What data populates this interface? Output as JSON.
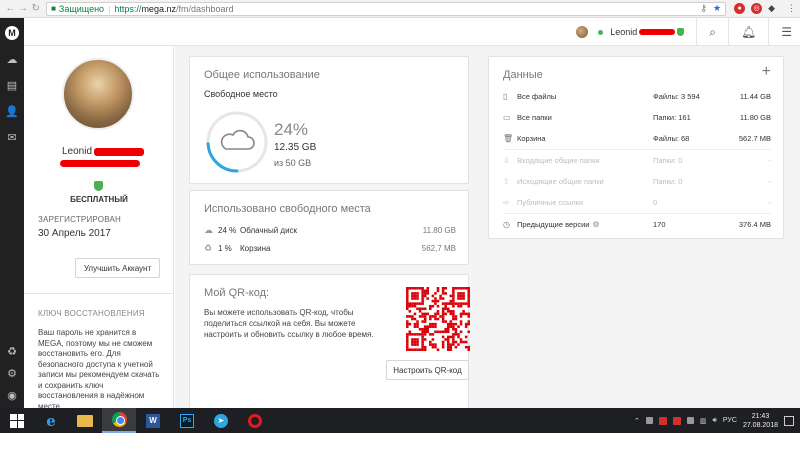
{
  "browser": {
    "secure_label": "Защищено",
    "url_proto": "https://",
    "url_host": "mega.nz",
    "url_path": "/fm/dashboard"
  },
  "rail": {
    "logo": "M"
  },
  "topbar": {
    "username": "Leonid"
  },
  "profile": {
    "name": "Leonid",
    "plan": "БЕСПЛАТНЫЙ",
    "registered_label": "ЗАРЕГИСТРИРОВАН",
    "registered_date": "30 Апрель 2017",
    "upgrade_button": "Улучшить Аккаунт",
    "recovery_title": "КЛЮЧ ВОССТАНОВЛЕНИЯ",
    "recovery_text": "Ваш пароль не хранится в MEGA, поэтому мы не сможем восстановить его. Для безопасного доступа к учетной записи мы рекомендуем скачать и сохранить ключ восстановления в надёжном месте."
  },
  "usage": {
    "title": "Общее использование",
    "subtitle": "Свободное место",
    "percent": "24%",
    "percent_value": 24,
    "used": "12.35 GB",
    "total": "из 50 GB"
  },
  "free_space": {
    "title": "Использовано свободного места",
    "rows": [
      {
        "icon": "cloud-icon",
        "pct": "24 %",
        "label": "Облачный диск",
        "size": "11.80 GB"
      },
      {
        "icon": "recycle-icon",
        "pct": "1 %",
        "label": "Корзина",
        "size": "562,7 MB"
      }
    ]
  },
  "qr": {
    "title": "Мой QR-код:",
    "text": "Вы можете использовать QR-код, чтобы поделиться ссылкой на себя. Вы можете настроить и обновить ссылку в любое время.",
    "button": "Настроить QR-код"
  },
  "data_card": {
    "title": "Данные",
    "add": "+",
    "rows": [
      {
        "label": "Все файлы",
        "count": "Файлы: 3 594",
        "size": "11.44 GB",
        "dim": false
      },
      {
        "label": "Все папки",
        "count": "Папки: 161",
        "size": "11.80 GB",
        "dim": false
      },
      {
        "label": "Корзина",
        "count": "Файлы: 68",
        "size": "562.7 MB",
        "dim": false
      },
      {
        "label": "Входящие общие папки",
        "count": "Папки: 0",
        "size": "-",
        "dim": true
      },
      {
        "label": "Исходящие общие папки",
        "count": "Папки: 0",
        "size": "-",
        "dim": true
      },
      {
        "label": "Публичные ссылки",
        "count": "0",
        "size": "-",
        "dim": true
      },
      {
        "label": "Предыдущие версии",
        "count": "170",
        "size": "376.4 MB",
        "dim": false
      }
    ]
  },
  "taskbar": {
    "lang": "РУС",
    "time": "21:43",
    "date": "27.08.2018"
  }
}
